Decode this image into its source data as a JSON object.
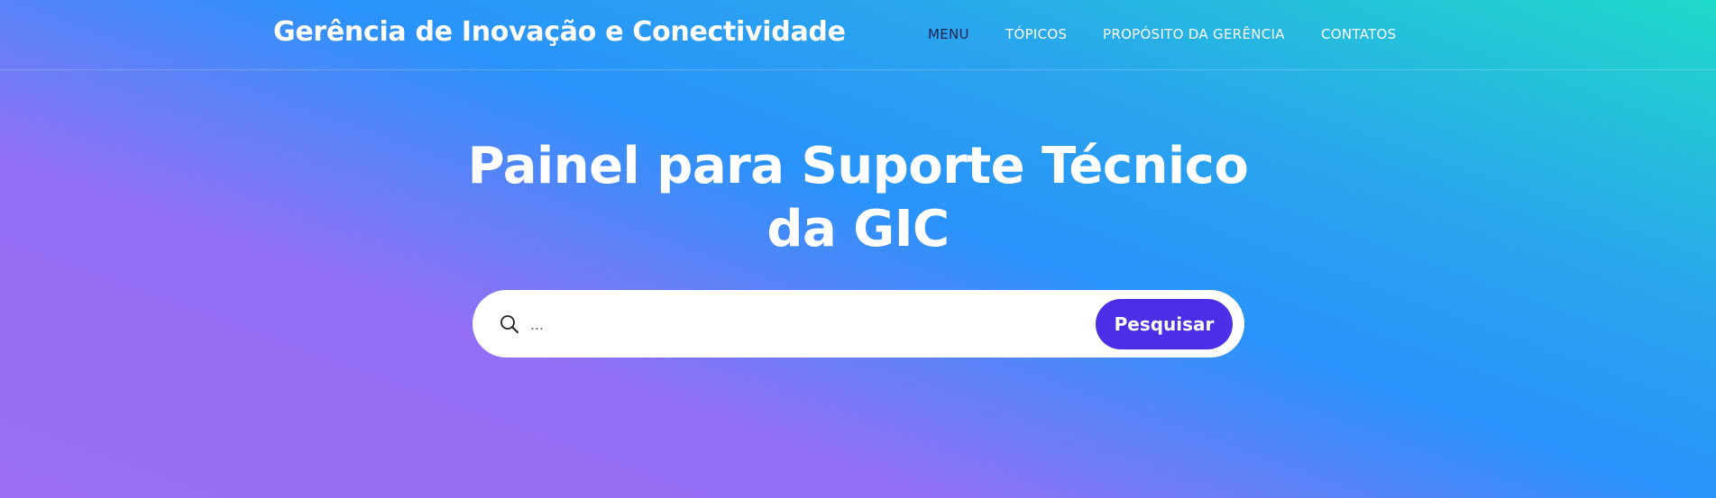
{
  "header": {
    "brand": "Gerência de Inovação e Conectividade",
    "nav": [
      {
        "label": "MENU",
        "active": true
      },
      {
        "label": "TÓPICOS",
        "active": false
      },
      {
        "label": "PROPÓSITO DA GERÊNCIA",
        "active": false
      },
      {
        "label": "CONTATOS",
        "active": false
      }
    ]
  },
  "hero": {
    "title_line1": "Painel para Suporte Técnico",
    "title_line2": "da GIC"
  },
  "search": {
    "icon": "search-icon",
    "placeholder": "...",
    "value": "",
    "button_label": "Pesquisar"
  },
  "colors": {
    "gradient_purple": "#9a6ff4",
    "gradient_blue": "#2a93fb",
    "gradient_teal": "#1fdac9",
    "button": "#4c2ee6",
    "nav_active": "#1b2250"
  }
}
